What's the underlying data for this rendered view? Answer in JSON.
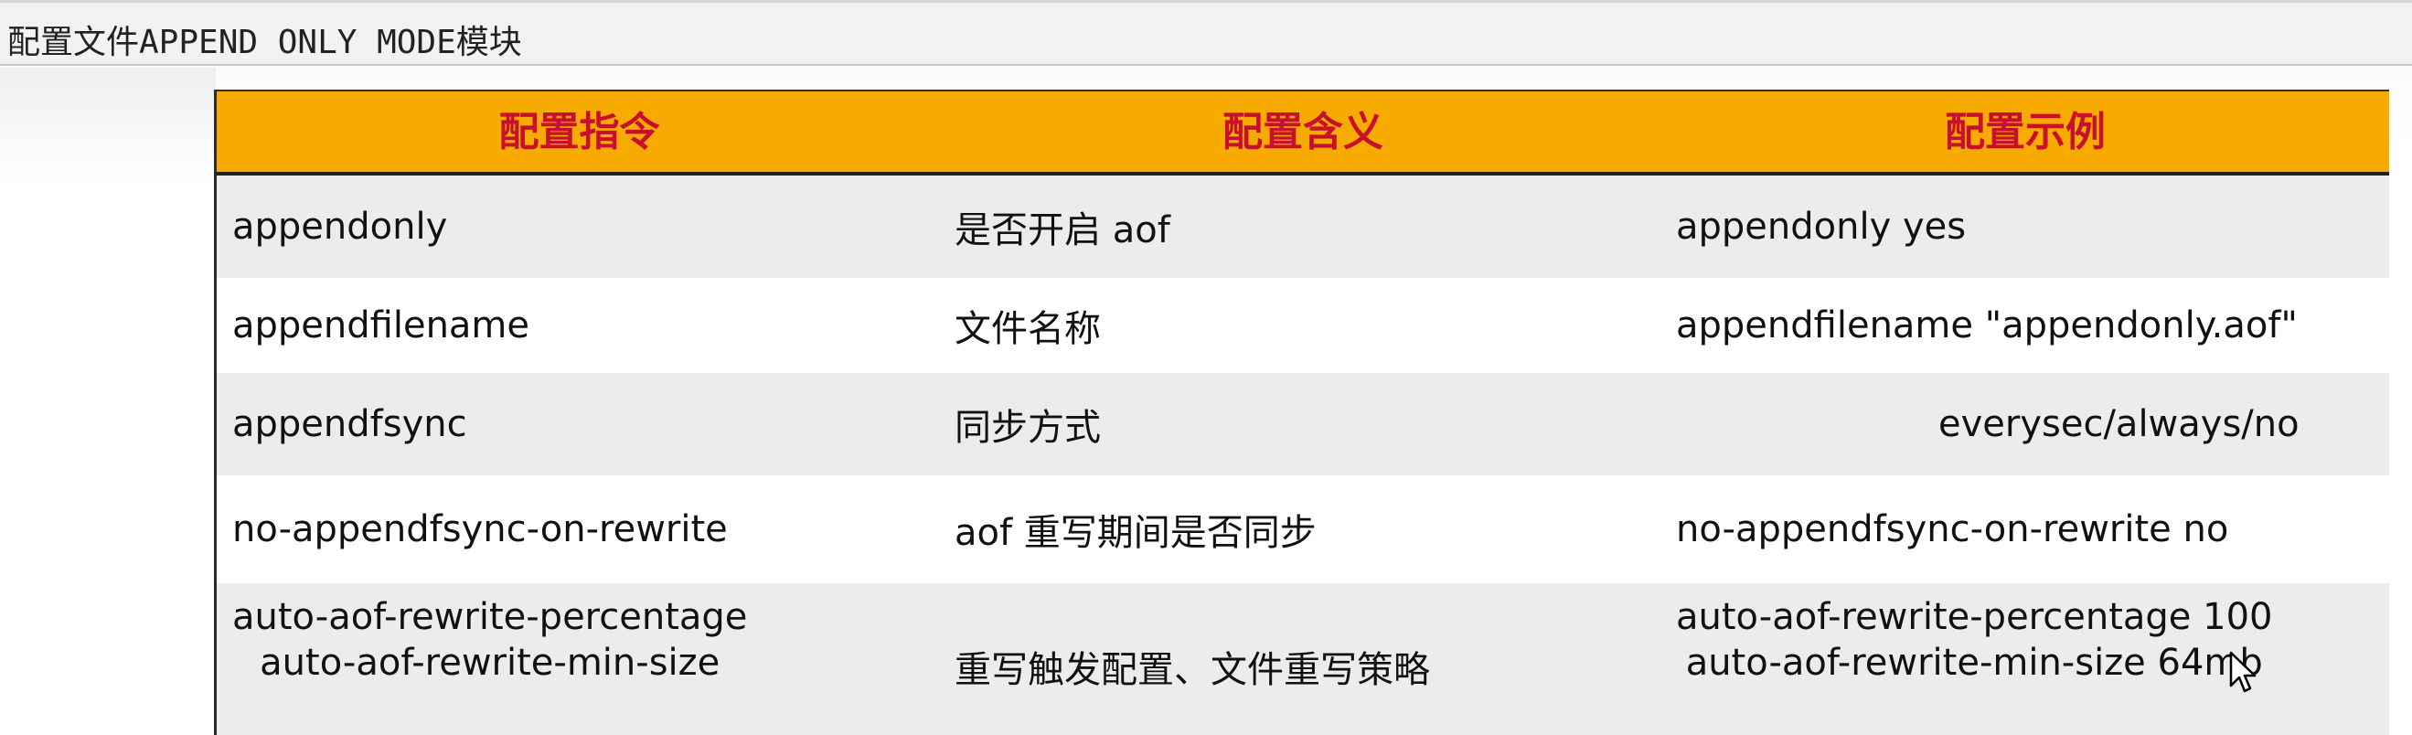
{
  "section_title": "配置文件APPEND ONLY MODE模块",
  "table": {
    "headers": [
      "配置指令",
      "配置含义",
      "配置示例"
    ],
    "rows": [
      {
        "directive": [
          "appendonly"
        ],
        "meaning": "是否开启 aof",
        "example": [
          "appendonly yes"
        ]
      },
      {
        "directive": [
          "appendfilename"
        ],
        "meaning": "文件名称",
        "example": [
          "appendfilename \"appendonly.aof\""
        ]
      },
      {
        "directive": [
          "appendfsync"
        ],
        "meaning": "同步方式",
        "example": [
          "everysec/always/no"
        ]
      },
      {
        "directive": [
          "no-appendfsync-on-rewrite"
        ],
        "meaning": "aof 重写期间是否同步",
        "example": [
          "no-appendfsync-on-rewrite no"
        ]
      },
      {
        "directive": [
          "auto-aof-rewrite-percentage",
          "auto-aof-rewrite-min-size"
        ],
        "meaning": "重写触发配置、文件重写策略",
        "example": [
          "auto-aof-rewrite-percentage 100",
          "auto-aof-rewrite-min-size 64mb"
        ]
      }
    ]
  },
  "colors": {
    "header_bg": "#f7aa00",
    "header_text": "#c8102e",
    "row_shaded": "#ececec",
    "row_white": "#ffffff"
  },
  "icons": {
    "cursor": "mouse-pointer-icon"
  }
}
